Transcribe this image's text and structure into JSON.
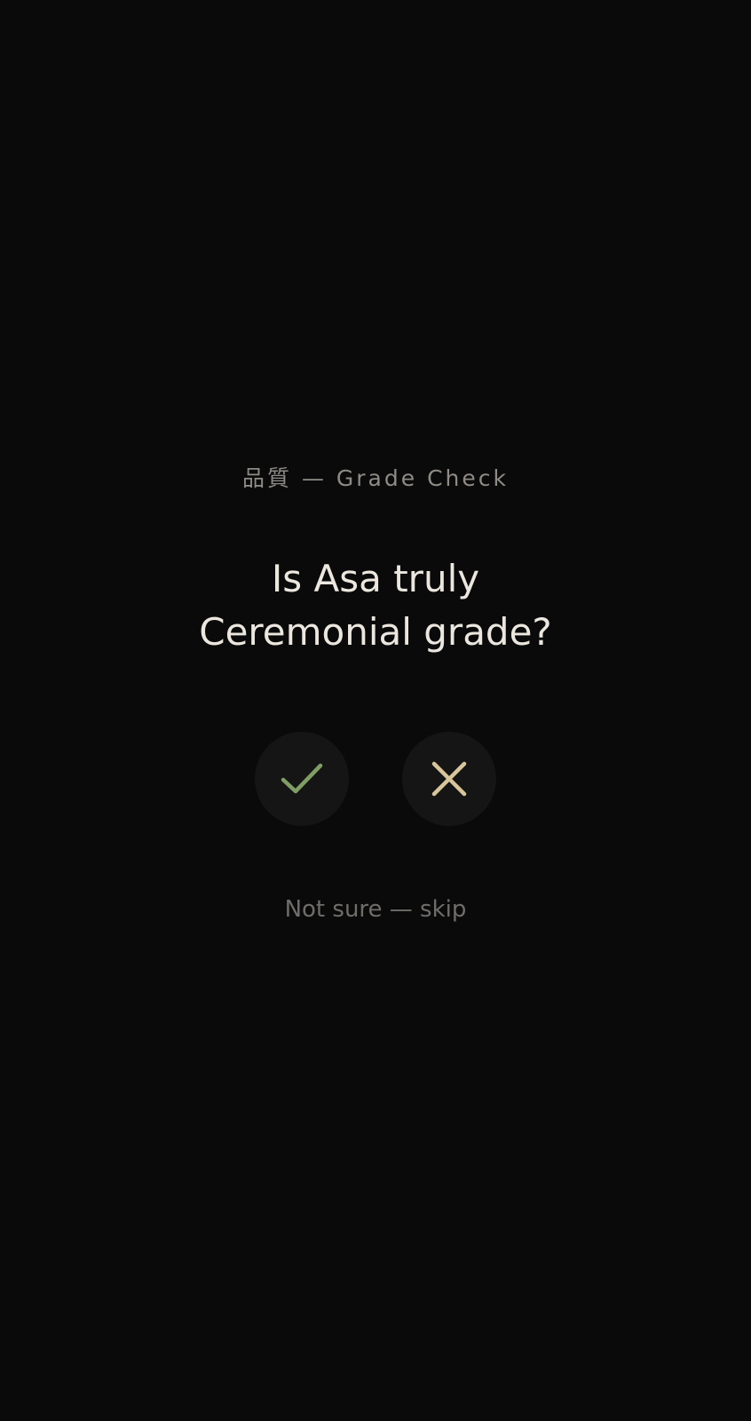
{
  "prompt": {
    "eyebrow": "品質 — Grade Check",
    "question_line1": "Is Asa truly",
    "question_line2": "Ceremonial grade?"
  },
  "actions": {
    "yes_icon": "checkmark-icon",
    "no_icon": "close-icon",
    "skip_label": "Not sure — skip"
  },
  "colors": {
    "background": "#0a0a0a",
    "button_fill": "#151515",
    "check": "#7f9e64",
    "cross": "#d8c69b",
    "text_primary": "#ebe7df",
    "text_secondary": "#8e8b86"
  }
}
